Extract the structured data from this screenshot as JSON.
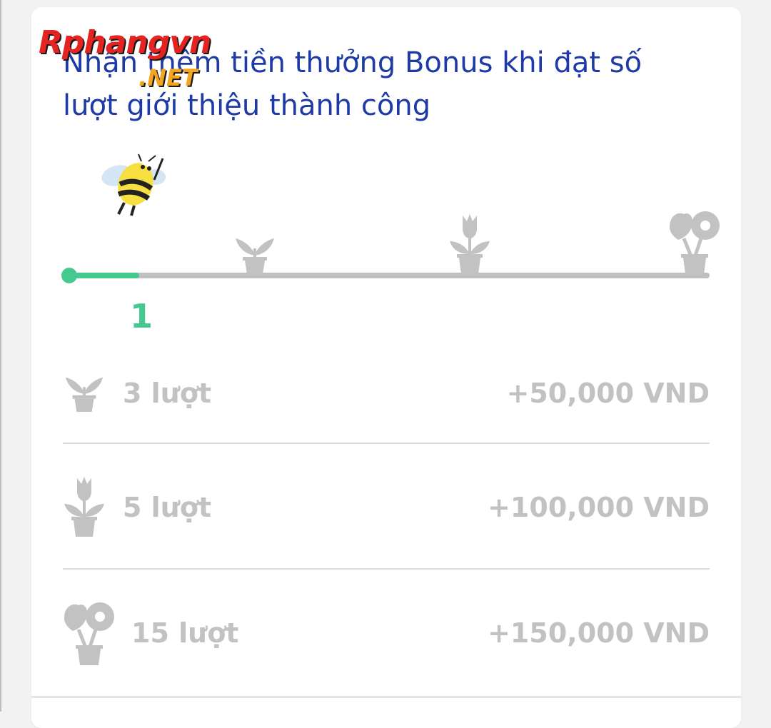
{
  "title": "Nhận thêm tiền thưởng Bonus khi đạt số lượt giới thiệu thành công",
  "watermark": {
    "main": "Rphangvn",
    "sub": ".NET"
  },
  "progress": {
    "current": "1",
    "fill_fraction": 0.11,
    "milestone_icons": [
      "sprout-pot-icon",
      "tulip-pot-icon",
      "flower-pot-icon"
    ]
  },
  "tiers": [
    {
      "icon": "sprout-pot-icon",
      "count": "3 lượt",
      "amount": "+50,000 VND"
    },
    {
      "icon": "tulip-pot-icon",
      "count": "5 lượt",
      "amount": "+100,000 VND"
    },
    {
      "icon": "flower-pot-icon",
      "count": "15 lượt",
      "amount": "+150,000 VND"
    }
  ],
  "colors": {
    "title": "#1f3aa6",
    "accent": "#46c98e",
    "inactive": "#c2c2c2",
    "track": "#bfbfbf"
  }
}
